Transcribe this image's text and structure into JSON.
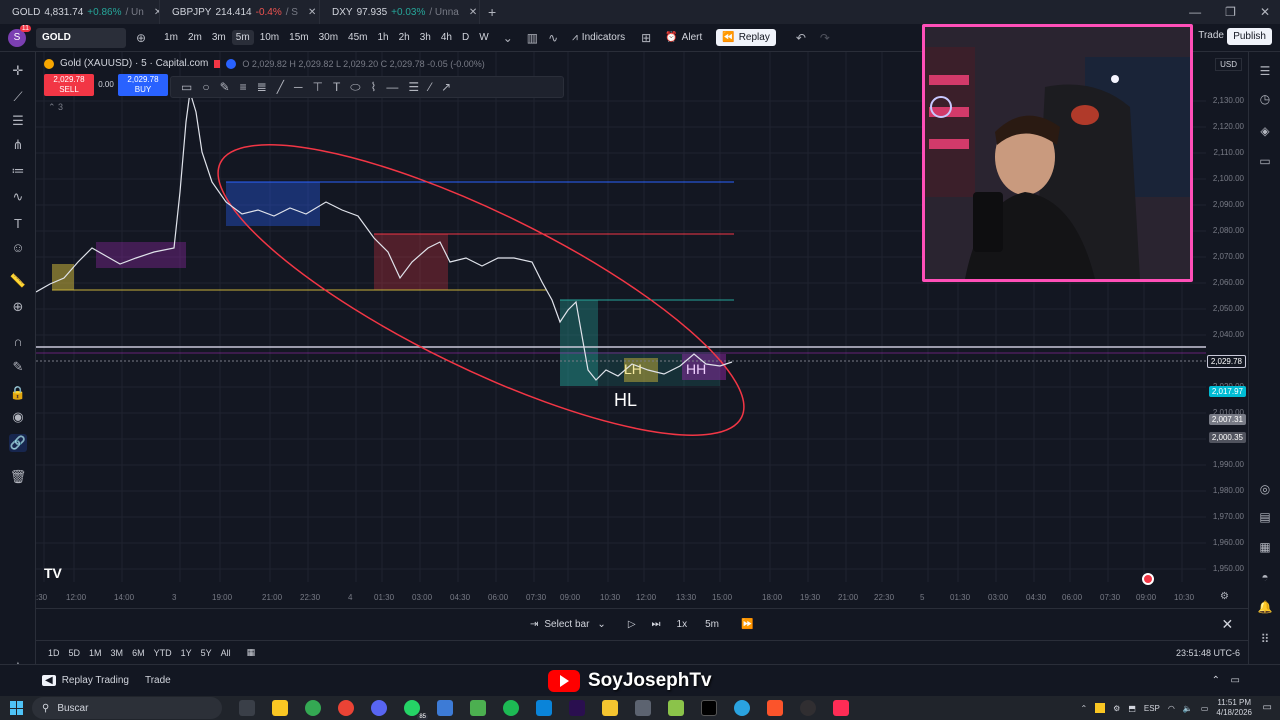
{
  "browser_tabs": [
    {
      "symbol": "GOLD",
      "price": "4,831.74",
      "change": "+0.86%",
      "suffix": "/ Un",
      "color": "#f7a600",
      "direction": "pos"
    },
    {
      "symbol": "GBPJPY",
      "price": "214.414",
      "change": "-0.4%",
      "suffix": "/ S",
      "color": "#7e57c2",
      "direction": "neg"
    },
    {
      "symbol": "DXY",
      "price": "97.935",
      "change": "+0.03%",
      "suffix": "/ Unna",
      "color": "#26a69a",
      "direction": "pos"
    }
  ],
  "toolbar": {
    "avatar_letter": "S",
    "avatar_badge": "11",
    "symbol": "GOLD",
    "timeframes": [
      "1m",
      "2m",
      "3m",
      "5m",
      "10m",
      "15m",
      "30m",
      "45m",
      "1h",
      "2h",
      "3h",
      "4h",
      "D",
      "W"
    ],
    "active_timeframe": "5m",
    "indicators_label": "Indicators",
    "alert_label": "Alert",
    "replay_label": "Replay",
    "trade_label": "Trade",
    "publish_label": "Publish"
  },
  "chart": {
    "instrument": "Gold (XAUUSD) · 5 · Capital.com",
    "ohlc": "O 2,029.82  H 2,029.82  L 2,029.20  C 2,029.78  -0.05 (-0.00%)",
    "sell_price": "2,029.78",
    "sell_label": "SELL",
    "spread": "0.00",
    "buy_price": "2,029.78",
    "buy_label": "BUY",
    "indicator_count": "3",
    "currency": "USD",
    "price_ticks": [
      "2,130.00",
      "2,120.00",
      "2,110.00",
      "2,100.00",
      "2,090.00",
      "2,080.00",
      "2,070.00",
      "2,060.00",
      "2,050.00",
      "2,040.00",
      "2,020.00",
      "2,010.00",
      "2,000.00",
      "1,990.00",
      "1,980.00",
      "1,970.00",
      "1,960.00",
      "1,950.00"
    ],
    "current_price": "2,029.78",
    "price_tag_cyan": "2,017.97",
    "price_tag_gray1": "2,007.31",
    "price_tag_gray2": "2,000.35",
    "time_ticks": [
      ":30",
      "12:00",
      "14:00",
      "3",
      "19:00",
      "21:00",
      "22:30",
      "4",
      "01:30",
      "03:00",
      "04:30",
      "06:00",
      "07:30",
      "09:00",
      "10:30",
      "12:00",
      "13:30",
      "15:00",
      "18:00",
      "19:30",
      "21:00",
      "22:30",
      "5",
      "01:30",
      "03:00",
      "04:30",
      "06:00",
      "07:30",
      "09:00",
      "10:30"
    ],
    "annotation_hl": "HL",
    "annotation_lh": "LH",
    "annotation_hh": "HH"
  },
  "replay": {
    "select_bar_label": "Select bar",
    "speed": "1x",
    "interval": "5m"
  },
  "ranges": [
    "1D",
    "5D",
    "1M",
    "3M",
    "6M",
    "YTD",
    "1Y",
    "5Y",
    "All"
  ],
  "clock": "23:51:48 UTC-6",
  "bottom_panel": {
    "replay_trading": "Replay Trading",
    "trade": "Trade"
  },
  "banner": "SoyJosephTv",
  "taskbar": {
    "search_placeholder": "Buscar",
    "lang": "ESP",
    "time": "11:51 PM",
    "date": "4/18/2026",
    "whatsapp_badge": "85"
  }
}
